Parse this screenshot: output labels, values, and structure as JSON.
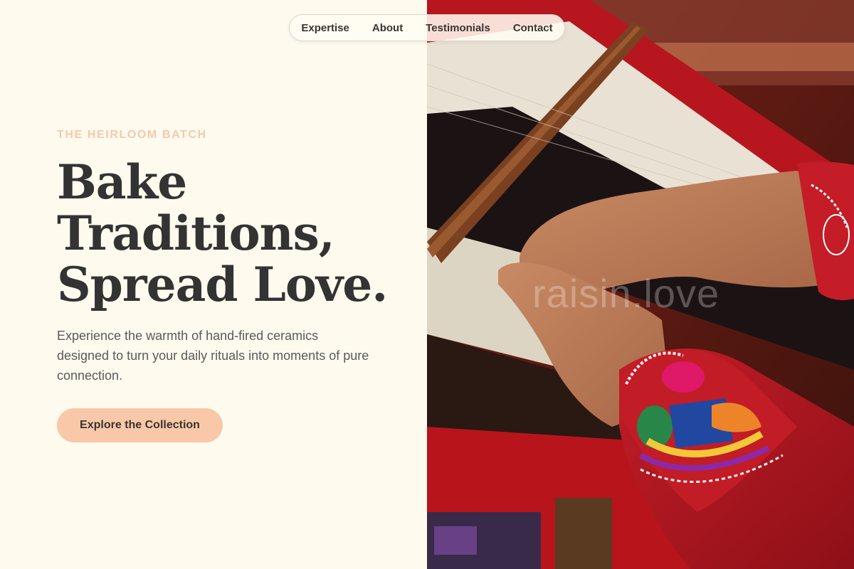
{
  "nav": {
    "items": [
      {
        "label": "Expertise"
      },
      {
        "label": "About"
      },
      {
        "label": "Testimonials"
      },
      {
        "label": "Contact"
      }
    ]
  },
  "hero": {
    "eyebrow": "THE HEIRLOOM BATCH",
    "headline_lines": [
      "Bake",
      "Traditions,",
      "Spread Love."
    ],
    "description": "Experience the warmth of hand-fired ceramics designed to turn your daily rituals into moments of pure connection.",
    "cta_label": "Explore the Collection"
  },
  "image": {
    "subject": "hands-weaving-on-loom",
    "watermark": "raisin.love"
  },
  "colors": {
    "background": "#fefaee",
    "accent": "#f8c8a8",
    "eyebrow": "#f6c9aa",
    "heading": "#333333",
    "body_text": "#5a5a5a"
  }
}
